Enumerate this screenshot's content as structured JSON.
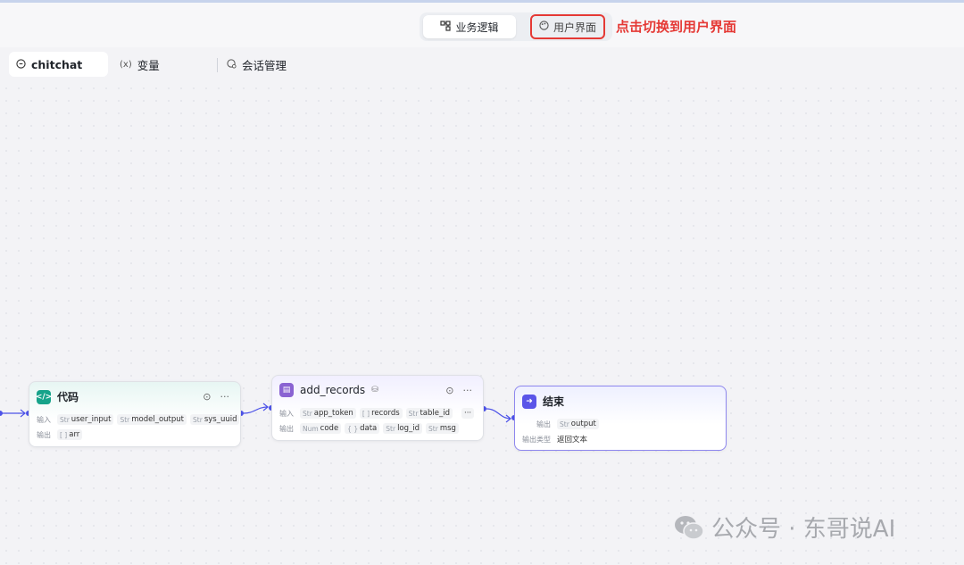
{
  "header": {
    "segments": [
      {
        "label": "业务逻辑",
        "icon": "flow-icon"
      },
      {
        "label": "用户界面",
        "icon": "palette-icon"
      }
    ],
    "annotation": "点击切换到用户界面"
  },
  "tabs": [
    {
      "label": "chitchat",
      "icon": "chat-icon"
    },
    {
      "label": "变量",
      "icon": "variable-icon",
      "icon_glyph": "(x)"
    },
    {
      "label": "会话管理",
      "icon": "session-icon"
    }
  ],
  "nodes": {
    "code": {
      "title": "代码",
      "input_label": "输入",
      "output_label": "输出",
      "inputs": [
        {
          "type": "Str",
          "name": "user_input"
        },
        {
          "type": "Str",
          "name": "model_output"
        },
        {
          "type": "Str",
          "name": "sys_uuid"
        }
      ],
      "outputs": [
        {
          "type": "[ ]",
          "name": "arr"
        }
      ]
    },
    "add_records": {
      "title": "add_records",
      "input_label": "输入",
      "output_label": "输出",
      "inputs": [
        {
          "type": "Str",
          "name": "app_token"
        },
        {
          "type": "[ ]",
          "name": "records"
        },
        {
          "type": "Str",
          "name": "table_id"
        }
      ],
      "outputs": [
        {
          "type": "Num",
          "name": "code"
        },
        {
          "type": "{ }",
          "name": "data"
        },
        {
          "type": "Str",
          "name": "log_id"
        },
        {
          "type": "Str",
          "name": "msg"
        }
      ],
      "more": "···"
    },
    "end": {
      "title": "结束",
      "output_label": "输出",
      "output": {
        "type": "Str",
        "name": "output"
      },
      "output_type_label": "输出类型",
      "output_type_value": "返回文本"
    }
  },
  "watermark": "公众号 · 东哥说AI",
  "colors": {
    "accent": "#4d53e8",
    "annotation": "#e53935",
    "code_icon": "#16a38a",
    "records_icon": "#8a63d2",
    "end_icon": "#5a55e8"
  }
}
